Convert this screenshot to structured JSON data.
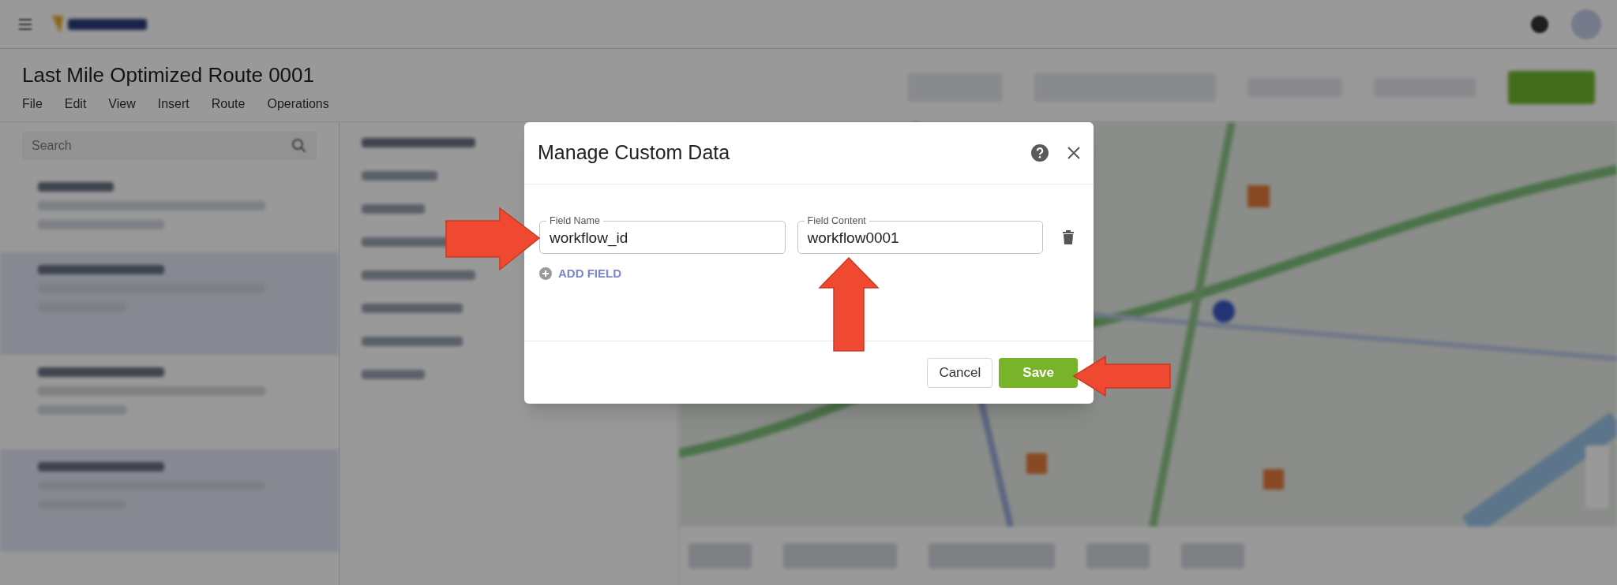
{
  "app": {
    "title": "Last Mile Optimized Route 0001",
    "menu": [
      "File",
      "Edit",
      "View",
      "Insert",
      "Route",
      "Operations"
    ],
    "search": {
      "placeholder": "Search"
    }
  },
  "dialog": {
    "title": "Manage Custom Data",
    "fields": [
      {
        "name_label": "Field Name",
        "name_value": "workflow_id",
        "content_label": "Field Content",
        "content_value": "workflow0001"
      }
    ],
    "add_field": "ADD FIELD",
    "buttons": [
      {
        "label": "Cancel",
        "kind": "secondary"
      },
      {
        "label": "Save",
        "kind": "primary"
      }
    ]
  }
}
